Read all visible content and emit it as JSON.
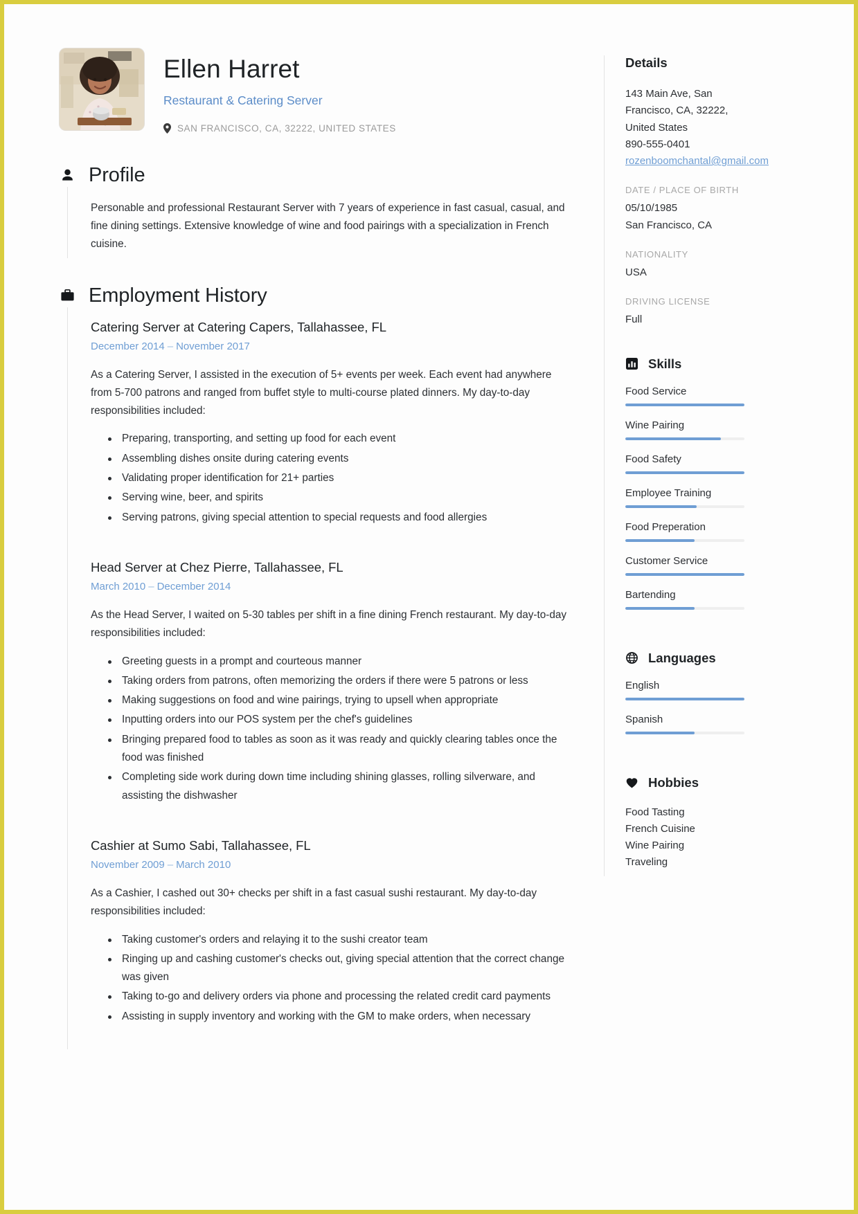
{
  "header": {
    "name": "Ellen Harret",
    "job_title": "Restaurant & Catering Server",
    "location": "SAN FRANCISCO, CA, 32222, UNITED STATES",
    "location_icon": "map-pin-icon",
    "photo_alt": "profile-photo"
  },
  "profile": {
    "icon": "person-icon",
    "title": "Profile",
    "text": "Personable and professional Restaurant Server with 7 years of experience in fast casual, casual, and fine dining settings. Extensive knowledge of wine and food pairings with a specialization in French cuisine."
  },
  "employment": {
    "icon": "briefcase-icon",
    "title": "Employment History",
    "jobs": [
      {
        "heading": "Catering Server at Catering Capers, Tallahassee, FL",
        "start": "December 2014",
        "end": "November 2017",
        "description": "As a Catering Server, I assisted in the execution of 5+ events per week. Each event had anywhere from 5-700 patrons and ranged from buffet style to multi-course plated dinners. My day-to-day responsibilities included:",
        "bullets": [
          "Preparing, transporting, and setting up food for each event",
          "Assembling dishes onsite during catering events",
          "Validating proper identification for 21+ parties",
          "Serving wine, beer, and spirits",
          "Serving patrons, giving special attention to special requests and food allergies"
        ]
      },
      {
        "heading": "Head Server at Chez Pierre, Tallahassee, FL",
        "start": "March 2010",
        "end": "December 2014",
        "description": "As the Head Server, I waited on 5-30 tables per shift in a fine dining French restaurant. My day-to-day responsibilities included:",
        "bullets": [
          "Greeting guests in a prompt and courteous manner",
          "Taking orders from patrons, often memorizing the orders if there were 5 patrons or less",
          "Making suggestions on food and wine pairings, trying to upsell when appropriate",
          "Inputting orders into our POS system per the chef's guidelines",
          "Bringing prepared food to tables as soon as it was ready and quickly clearing tables once the food was finished",
          "Completing side work during down time including shining glasses, rolling silverware, and assisting the dishwasher"
        ]
      },
      {
        "heading": "Cashier at Sumo Sabi, Tallahassee, FL",
        "start": "November 2009",
        "end": "March 2010",
        "description": "As a Cashier, I cashed out 30+ checks per shift in a fast casual sushi restaurant. My day-to-day responsibilities included:",
        "bullets": [
          "Taking customer's orders and relaying it to the sushi creator team",
          "Ringing up and cashing customer's checks out, giving special attention that the correct change was given",
          "Taking to-go and delivery orders via phone and processing the related credit card payments",
          "Assisting in supply inventory and working with the GM to make orders, when necessary"
        ]
      }
    ]
  },
  "details": {
    "title": "Details",
    "address_lines": [
      "143 Main Ave, San",
      "Francisco, CA, 32222,",
      "United States"
    ],
    "phone": "890-555-0401",
    "email": "rozenboomchantal@gmail.com",
    "dob_label": "DATE / PLACE OF BIRTH",
    "dob_value": "05/10/1985",
    "birth_place": "San Francisco, CA",
    "nationality_label": "NATIONALITY",
    "nationality_value": "USA",
    "license_label": "DRIVING LICENSE",
    "license_value": "Full"
  },
  "skills": {
    "icon": "bar-chart-icon",
    "title": "Skills",
    "items": [
      {
        "name": "Food Service",
        "level": 100
      },
      {
        "name": "Wine Pairing",
        "level": 80
      },
      {
        "name": "Food Safety",
        "level": 100
      },
      {
        "name": "Employee Training",
        "level": 60
      },
      {
        "name": "Food Preperation",
        "level": 58
      },
      {
        "name": "Customer Service",
        "level": 100
      },
      {
        "name": "Bartending",
        "level": 58
      }
    ]
  },
  "languages": {
    "icon": "globe-icon",
    "title": "Languages",
    "items": [
      {
        "name": "English",
        "level": 100
      },
      {
        "name": "Spanish",
        "level": 58
      }
    ]
  },
  "hobbies": {
    "icon": "heart-icon",
    "title": "Hobbies",
    "items": [
      "Food Tasting",
      "French Cuisine",
      "Wine Pairing",
      "Traveling"
    ]
  },
  "colors": {
    "accent": "#6f9ed4",
    "text": "#2c2f33",
    "muted": "#a8a8a8",
    "border": "#e3e3e3",
    "page_border": "#d9cd3f"
  }
}
